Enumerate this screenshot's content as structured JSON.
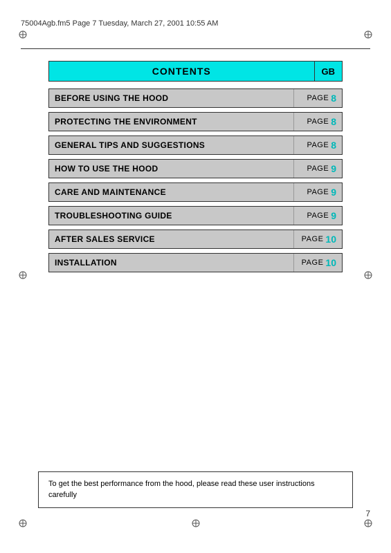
{
  "header": {
    "filename": "75004Agb.fm5  Page 7  Tuesday, March 27, 2001  10:55 AM"
  },
  "contents": {
    "title": "CONTENTS",
    "gb_label": "GB"
  },
  "toc_items": [
    {
      "label": "BEFORE USING THE HOOD",
      "page_word": "PAGE",
      "page_num": "8"
    },
    {
      "label": "PROTECTING THE ENVIRONMENT",
      "page_word": "PAGE",
      "page_num": "8"
    },
    {
      "label": "GENERAL TIPS AND SUGGESTIONS",
      "page_word": "PAGE",
      "page_num": "8"
    },
    {
      "label": "HOW TO USE THE HOOD",
      "page_word": "PAGE",
      "page_num": "9"
    },
    {
      "label": "CARE AND MAINTENANCE",
      "page_word": "PAGE",
      "page_num": "9"
    },
    {
      "label": "TROUBLESHOOTING GUIDE",
      "page_word": "PAGE",
      "page_num": "9"
    },
    {
      "label": "AFTER SALES SERVICE",
      "page_word": "PAGE",
      "page_num": "10"
    },
    {
      "label": "INSTALLATION",
      "page_word": "PAGE",
      "page_num": "10"
    }
  ],
  "bottom_note": "To get the best performance from the hood, please read these user instructions carefully",
  "page_number": "7"
}
